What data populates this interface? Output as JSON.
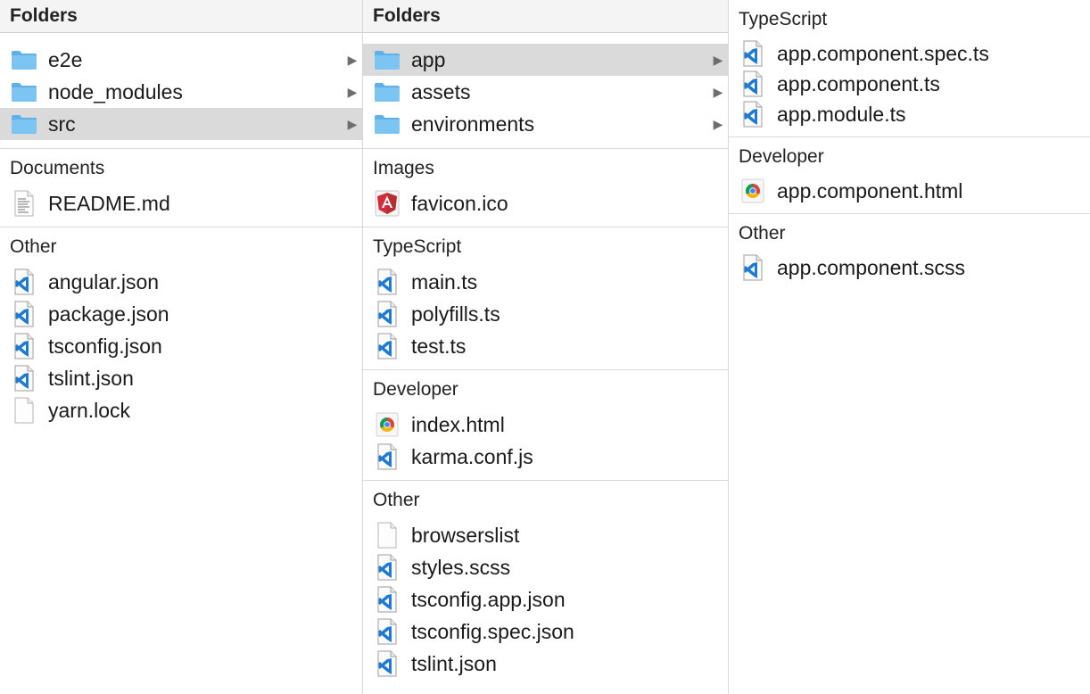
{
  "colors": {
    "folder": "#7cc5f2",
    "folder_dark": "#5eb0e6",
    "selection": "#dadada",
    "vscode_blue": "#1f7ad1",
    "angular_red": "#d12d3a"
  },
  "columns": [
    {
      "sections": [
        {
          "kind": "folders",
          "title": "Folders",
          "items": [
            {
              "label": "e2e",
              "icon": "folder-icon",
              "chevron": true,
              "selected": false
            },
            {
              "label": "node_modules",
              "icon": "folder-icon",
              "chevron": true,
              "selected": false
            },
            {
              "label": "src",
              "icon": "folder-icon",
              "chevron": true,
              "selected": true
            }
          ]
        },
        {
          "kind": "group",
          "title": "Documents",
          "items": [
            {
              "label": "README.md",
              "icon": "text-document-icon"
            }
          ]
        },
        {
          "kind": "group",
          "title": "Other",
          "items": [
            {
              "label": "angular.json",
              "icon": "vscode-file-icon"
            },
            {
              "label": "package.json",
              "icon": "vscode-file-icon"
            },
            {
              "label": "tsconfig.json",
              "icon": "vscode-file-icon"
            },
            {
              "label": "tslint.json",
              "icon": "vscode-file-icon"
            },
            {
              "label": "yarn.lock",
              "icon": "blank-file-icon"
            }
          ]
        }
      ]
    },
    {
      "sections": [
        {
          "kind": "folders",
          "title": "Folders",
          "items": [
            {
              "label": "app",
              "icon": "folder-icon",
              "chevron": true,
              "selected": true
            },
            {
              "label": "assets",
              "icon": "folder-icon",
              "chevron": true,
              "selected": false
            },
            {
              "label": "environments",
              "icon": "folder-icon",
              "chevron": true,
              "selected": false
            }
          ]
        },
        {
          "kind": "group",
          "title": "Images",
          "items": [
            {
              "label": "favicon.ico",
              "icon": "angular-icon"
            }
          ]
        },
        {
          "kind": "group",
          "title": "TypeScript",
          "items": [
            {
              "label": "main.ts",
              "icon": "vscode-file-icon"
            },
            {
              "label": "polyfills.ts",
              "icon": "vscode-file-icon"
            },
            {
              "label": "test.ts",
              "icon": "vscode-file-icon"
            }
          ]
        },
        {
          "kind": "group",
          "title": "Developer",
          "items": [
            {
              "label": "index.html",
              "icon": "chrome-icon"
            },
            {
              "label": "karma.conf.js",
              "icon": "vscode-file-icon"
            }
          ]
        },
        {
          "kind": "group",
          "title": "Other",
          "items": [
            {
              "label": "browserslist",
              "icon": "blank-file-icon"
            },
            {
              "label": "styles.scss",
              "icon": "vscode-file-icon"
            },
            {
              "label": "tsconfig.app.json",
              "icon": "vscode-file-icon"
            },
            {
              "label": "tsconfig.spec.json",
              "icon": "vscode-file-icon"
            },
            {
              "label": "tslint.json",
              "icon": "vscode-file-icon"
            }
          ]
        }
      ]
    },
    {
      "sections": [
        {
          "kind": "group",
          "title": "TypeScript",
          "items": [
            {
              "label": "app.component.spec.ts",
              "icon": "vscode-file-icon"
            },
            {
              "label": "app.component.ts",
              "icon": "vscode-file-icon"
            },
            {
              "label": "app.module.ts",
              "icon": "vscode-file-icon"
            }
          ]
        },
        {
          "kind": "group",
          "title": "Developer",
          "items": [
            {
              "label": "app.component.html",
              "icon": "chrome-icon"
            }
          ]
        },
        {
          "kind": "group",
          "title": "Other",
          "items": [
            {
              "label": "app.component.scss",
              "icon": "vscode-file-icon"
            }
          ]
        }
      ]
    }
  ]
}
